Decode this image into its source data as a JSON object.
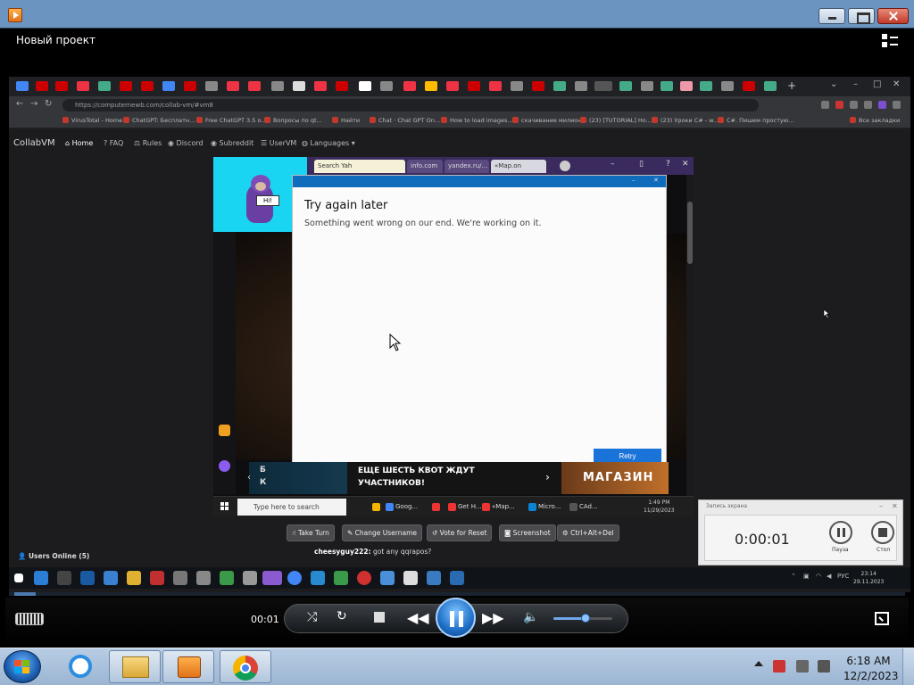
{
  "player": {
    "project_title": "Новый проект",
    "elapsed": "00:01"
  },
  "browser": {
    "url": "https://computernewb.com/collab-vm/#vm8",
    "bookmarks": [
      "VirusTotal - Home",
      "ChatGPT: Бесплатн...",
      "Free ChatGPT 3.5 o...",
      "Вопросы по qt...",
      "Найти",
      "Chat · Chat GPT On...",
      "How to load images...",
      "скачивание милион...",
      "(23) [TUTORIAL] Ho...",
      "(23) Уроки C# - w...",
      "C#. Пишем простую...",
      "Все закладки"
    ]
  },
  "collabvm": {
    "brand": "CollabVM",
    "nav": [
      {
        "icon": "home-icon",
        "label": "Home"
      },
      {
        "icon": "question-icon",
        "label": "FAQ"
      },
      {
        "icon": "gavel-icon",
        "label": "Rules"
      },
      {
        "icon": "discord-icon",
        "label": "Discord"
      },
      {
        "icon": "reddit-icon",
        "label": "Subreddit"
      },
      {
        "icon": "users-icon",
        "label": "UserVM"
      },
      {
        "icon": "globe-icon",
        "label": "Languages"
      }
    ],
    "buttons": {
      "take_turn": "Take Turn",
      "change_username": "Change Username",
      "vote_reset": "Vote for Reset",
      "screenshot": "Screenshot",
      "ctrl_alt_del": "Ctrl+Alt+Del"
    },
    "users_online": "Users Online (5)",
    "chat": {
      "user": "cheesyguy222:",
      "text": "got any qqrapos?"
    }
  },
  "vm": {
    "tabs": [
      "Search Yah",
      "info.com",
      "yandex.ru/...",
      "«Map.on"
    ],
    "bonzi_speech": "Hi!",
    "dialog": {
      "title": "Try again later",
      "message": "Something went wrong on our end. We're working on it.",
      "button": "Retry"
    },
    "banners": {
      "line1": "ЕЩЕ ШЕСТЬ КВОТ ЖДУТ",
      "line2": "УЧАСТНИКОВ!",
      "shop": "МАГАЗИН",
      "left1": "Б",
      "left2": "К"
    },
    "taskbar": {
      "search_placeholder": "Type here to search",
      "apps": [
        "Goog...",
        "Get H...",
        "«Map...",
        "Micro...",
        "CAd..."
      ],
      "time": "1:49 PM",
      "date": "11/29/2023"
    }
  },
  "recorder": {
    "title": "Запись экрана",
    "time": "0:00:01",
    "pause_label": "Пауза",
    "stop_label": "Стоп"
  },
  "host_taskbar": {
    "lang": "РУС",
    "time": "23:14",
    "date": "29.11.2023"
  },
  "os_taskbar": {
    "time": "6:18 AM",
    "date": "12/2/2023"
  },
  "colors": {
    "accent": "#1a73d8",
    "bonzi_bg": "#1ad5f2",
    "taskbar": "#9bb5d2"
  },
  "volume_level": 0.55
}
